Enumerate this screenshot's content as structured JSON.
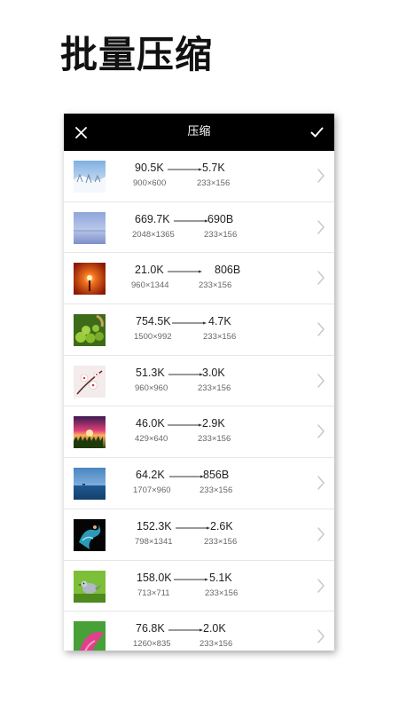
{
  "promo": {
    "title": "批量压缩"
  },
  "app_bar": {
    "title": "压缩",
    "close_icon": "close-icon",
    "confirm_icon": "checkmark-icon"
  },
  "colors": {
    "app_bar_bg": "#000000",
    "app_bar_text": "#ffffff",
    "divider": "#e6e6e6",
    "chevron": "#c8c8cc"
  },
  "items": [
    {
      "original_size": "90.5K",
      "compressed_size": "5.7K",
      "original_dims": "900×600",
      "compressed_dims": "233×156",
      "thumbnail": "snowy-landscape"
    },
    {
      "original_size": "669.7K",
      "compressed_size": "690B",
      "original_dims": "2048×1365",
      "compressed_dims": "233×156",
      "thumbnail": "misty-blue-lake"
    },
    {
      "original_size": "21.0K",
      "compressed_size": "806B",
      "original_dims": "960×1344",
      "compressed_dims": "233×156",
      "thumbnail": "orange-sunset"
    },
    {
      "original_size": "754.5K",
      "compressed_size": "4.7K",
      "original_dims": "1500×992",
      "compressed_dims": "233×156",
      "thumbnail": "green-peas-macro"
    },
    {
      "original_size": "51.3K",
      "compressed_size": "3.0K",
      "original_dims": "960×960",
      "compressed_dims": "233×156",
      "thumbnail": "white-blossoms"
    },
    {
      "original_size": "46.0K",
      "compressed_size": "2.9K",
      "original_dims": "429×640",
      "compressed_dims": "233×156",
      "thumbnail": "pink-sunset-field"
    },
    {
      "original_size": "64.2K",
      "compressed_size": "856B",
      "original_dims": "1707×960",
      "compressed_dims": "233×156",
      "thumbnail": "blue-sea"
    },
    {
      "original_size": "152.3K",
      "compressed_size": "2.6K",
      "original_dims": "798×1341",
      "compressed_dims": "233×156",
      "thumbnail": "blue-dancer"
    },
    {
      "original_size": "158.0K",
      "compressed_size": "5.1K",
      "original_dims": "713×711",
      "compressed_dims": "233×156",
      "thumbnail": "bird-on-grass"
    },
    {
      "original_size": "76.8K",
      "compressed_size": "2.0K",
      "original_dims": "1260×835",
      "compressed_dims": "233×156",
      "thumbnail": "pink-flower"
    }
  ]
}
